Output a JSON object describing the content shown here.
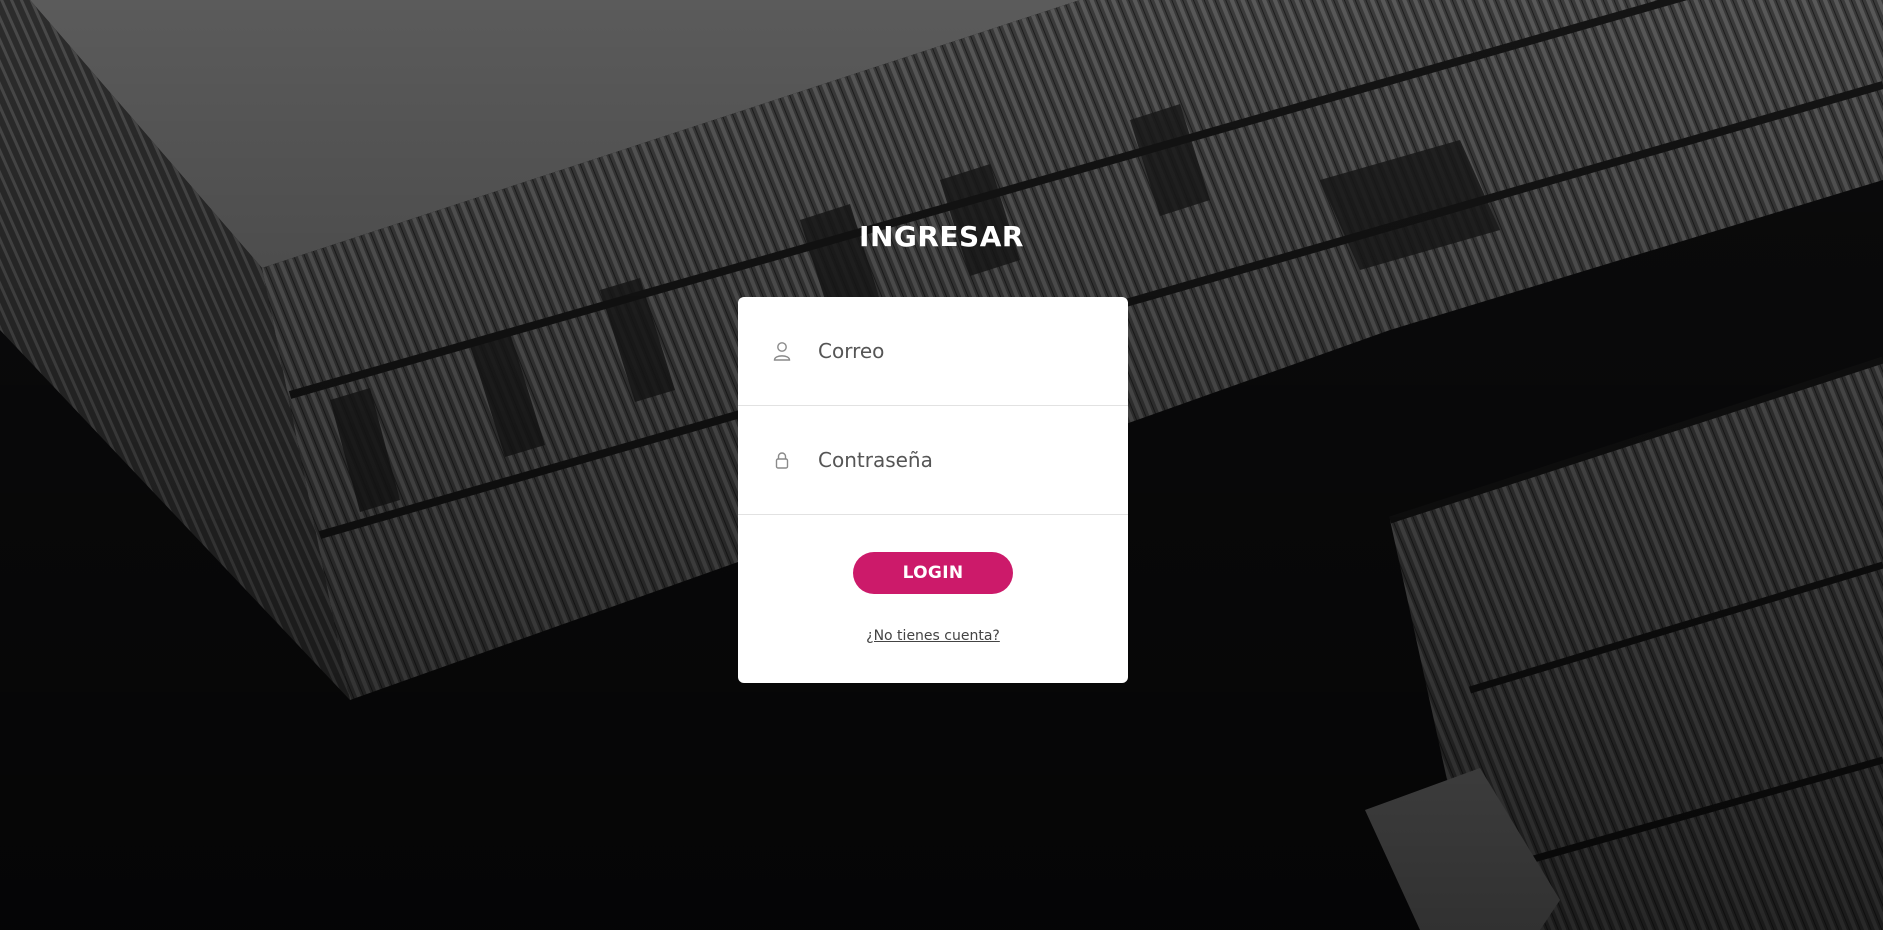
{
  "page": {
    "title": "INGRESAR"
  },
  "form": {
    "email": {
      "placeholder": "Correo",
      "value": "",
      "icon": "user-icon"
    },
    "password": {
      "placeholder": "Contraseña",
      "value": "",
      "icon": "lock-icon"
    },
    "login_label": "LOGIN",
    "signup_link": "¿No tienes cuenta?"
  },
  "colors": {
    "accent": "#cc1a6a",
    "background": "#0a0a0b",
    "card": "#ffffff"
  }
}
